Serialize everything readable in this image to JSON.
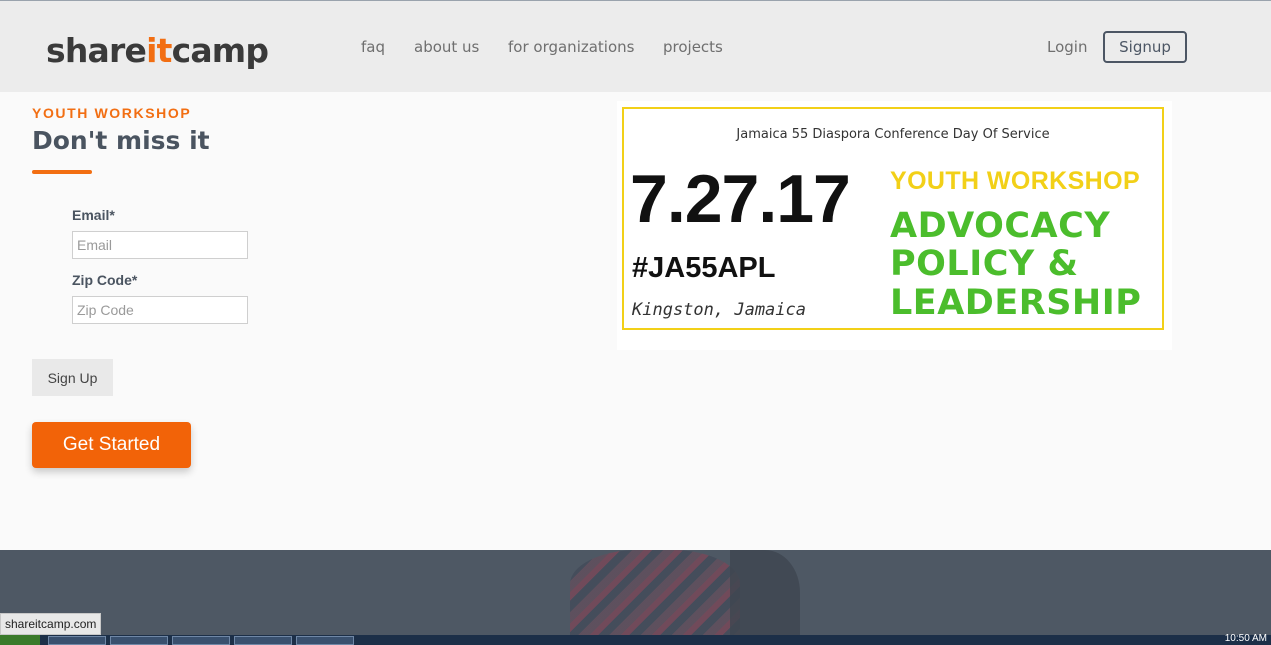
{
  "header": {
    "logo": {
      "part1": "share",
      "part2": "it",
      "part3": "camp"
    },
    "nav": [
      "faq",
      "about us",
      "for organizations",
      "projects"
    ],
    "login": "Login",
    "signup": "Signup"
  },
  "main": {
    "eyebrow": "YOUTH WORKSHOP",
    "title": "Don't miss it",
    "form": {
      "email_label": "Email*",
      "email_placeholder": "Email",
      "zip_label": "Zip Code*",
      "zip_placeholder": "Zip Code",
      "submit": "Sign Up"
    },
    "cta": "Get Started"
  },
  "banner": {
    "subtitle": "Jamaica 55 Diaspora Conference Day Of Service",
    "date": "7.27.17",
    "hashtag": "#JA55APL",
    "location": "Kingston, Jamaica",
    "workshop": "YOUTH WORKSHOP",
    "lines": [
      "ADVOCACY",
      "POLICY &",
      "LEADERSHIP"
    ]
  },
  "status_bar": "shareitcamp.com",
  "taskbar": {
    "clock": "10:50 AM"
  },
  "colors": {
    "accent": "#f26e12",
    "banner_yellow": "#f2d018",
    "banner_green": "#4bbd2c"
  }
}
